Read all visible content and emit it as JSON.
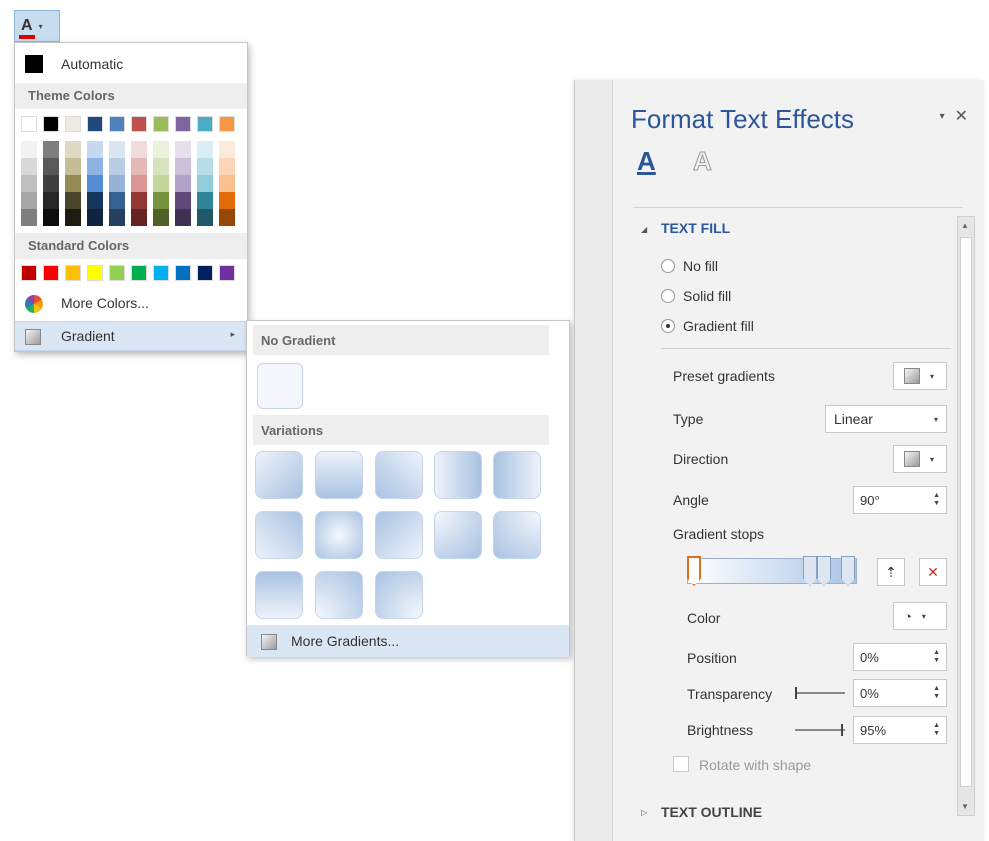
{
  "font_color_button": {
    "glyph": "A",
    "arrow": "▾",
    "underline_color": "#e00000"
  },
  "color_menu": {
    "automatic_label": "Automatic",
    "theme_colors_header": "Theme Colors",
    "theme_colors": [
      "#ffffff",
      "#000000",
      "#eeece1",
      "#1f497d",
      "#4f81bd",
      "#c0504d",
      "#9bbb59",
      "#8064a2",
      "#4bacc6",
      "#f79646"
    ],
    "theme_tints": [
      [
        "#f2f2f2",
        "#d9d9d9",
        "#bfbfbf",
        "#a6a6a6",
        "#7f7f7f"
      ],
      [
        "#7f7f7f",
        "#595959",
        "#404040",
        "#262626",
        "#0d0d0d"
      ],
      [
        "#ddd9c3",
        "#c4bd97",
        "#948a54",
        "#4a452a",
        "#1e1c11"
      ],
      [
        "#c6d9f0",
        "#8db3e2",
        "#548dd4",
        "#17365d",
        "#0f243e"
      ],
      [
        "#dbe5f1",
        "#b8cce4",
        "#95b3d7",
        "#366092",
        "#244061"
      ],
      [
        "#f2dcdb",
        "#e5b9b7",
        "#d99694",
        "#953734",
        "#632423"
      ],
      [
        "#ebf1dd",
        "#d7e3bc",
        "#c3d69b",
        "#76923c",
        "#4f6128"
      ],
      [
        "#e5e0ec",
        "#ccc1d9",
        "#b2a2c7",
        "#5f497a",
        "#3f3151"
      ],
      [
        "#dbeef3",
        "#b7dde8",
        "#92cddc",
        "#31859b",
        "#205867"
      ],
      [
        "#fdeada",
        "#fbd5b5",
        "#fac08f",
        "#e36c09",
        "#974806"
      ]
    ],
    "standard_colors_header": "Standard Colors",
    "standard_colors": [
      "#c00000",
      "#ff0000",
      "#ffc000",
      "#ffff00",
      "#92d050",
      "#00b050",
      "#00b0f0",
      "#0070c0",
      "#002060",
      "#7030a0"
    ],
    "more_colors_label": "More Colors...",
    "gradient_label": "Gradient",
    "submenu_arrow": "▸"
  },
  "gradient_menu": {
    "no_gradient_header": "No Gradient",
    "variations_header": "Variations",
    "more_gradients_label": "More Gradients..."
  },
  "pane": {
    "title": "Format Text Effects",
    "pin_glyph": "▾",
    "close_glyph": "✕",
    "tab_fill_glyph": "A",
    "tab_outline_glyph": "A",
    "text_fill": {
      "header": "TEXT FILL",
      "collapse_glyph": "◢",
      "options": [
        "No fill",
        "Solid fill",
        "Gradient fill"
      ],
      "selected_option": "Gradient fill",
      "preset_gradients_label": "Preset gradients",
      "type_label": "Type",
      "type_value": "Linear",
      "direction_label": "Direction",
      "angle_label": "Angle",
      "angle_value": "90°",
      "gradient_stops_label": "Gradient stops",
      "color_label": "Color",
      "position_label": "Position",
      "position_value": "0%",
      "transparency_label": "Transparency",
      "transparency_value": "0%",
      "transparency_level": 0,
      "brightness_label": "Brightness",
      "brightness_value": "95%",
      "brightness_level": 0.95,
      "rotate_label": "Rotate with shape"
    },
    "text_outline": {
      "header": "TEXT OUTLINE",
      "expand_glyph": "▷"
    },
    "scroll_up": "▲",
    "scroll_down": "▼",
    "accent_color": "#2b579a"
  }
}
